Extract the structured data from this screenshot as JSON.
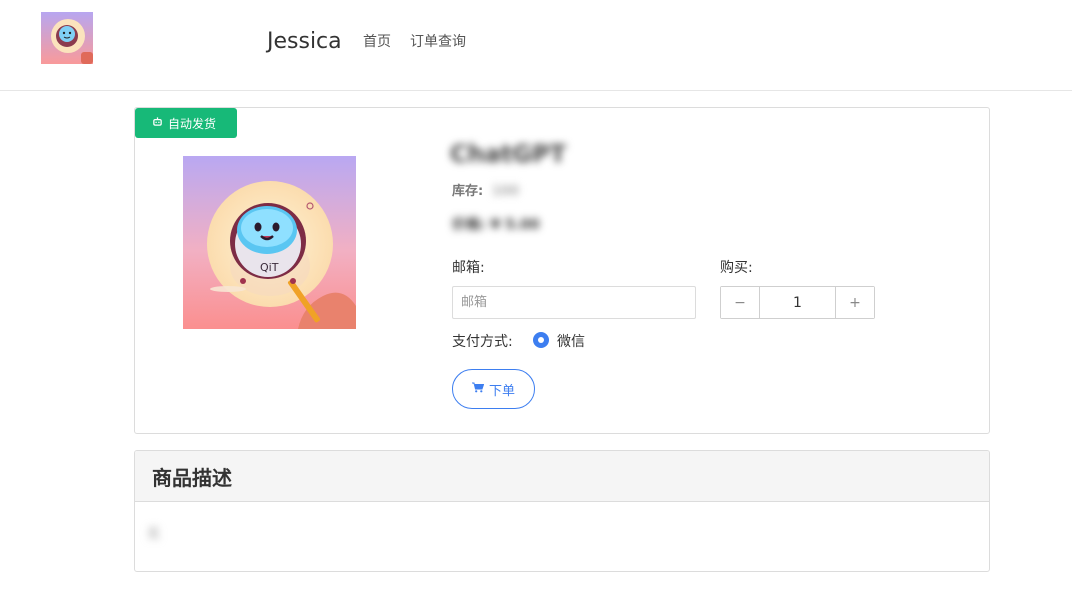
{
  "nav": {
    "brand": "Jessica",
    "links": [
      "首页",
      "订单查询"
    ]
  },
  "product": {
    "badge": "自动发货",
    "name": "ChatGPT",
    "stock_label": "库存:",
    "stock_value": "100",
    "price": "价格: ¥ 5.00",
    "email_label": "邮箱:",
    "email_placeholder": "邮箱",
    "quantity_label": "购买:",
    "quantity": "1",
    "minus": "−",
    "plus": "+",
    "payment_label": "支付方式:",
    "payment_option": "微信",
    "order_button": "下单"
  },
  "description": {
    "title": "商品描述",
    "body": "无"
  },
  "colors": {
    "badge": "#17b978",
    "accent": "#3d7ef0"
  }
}
